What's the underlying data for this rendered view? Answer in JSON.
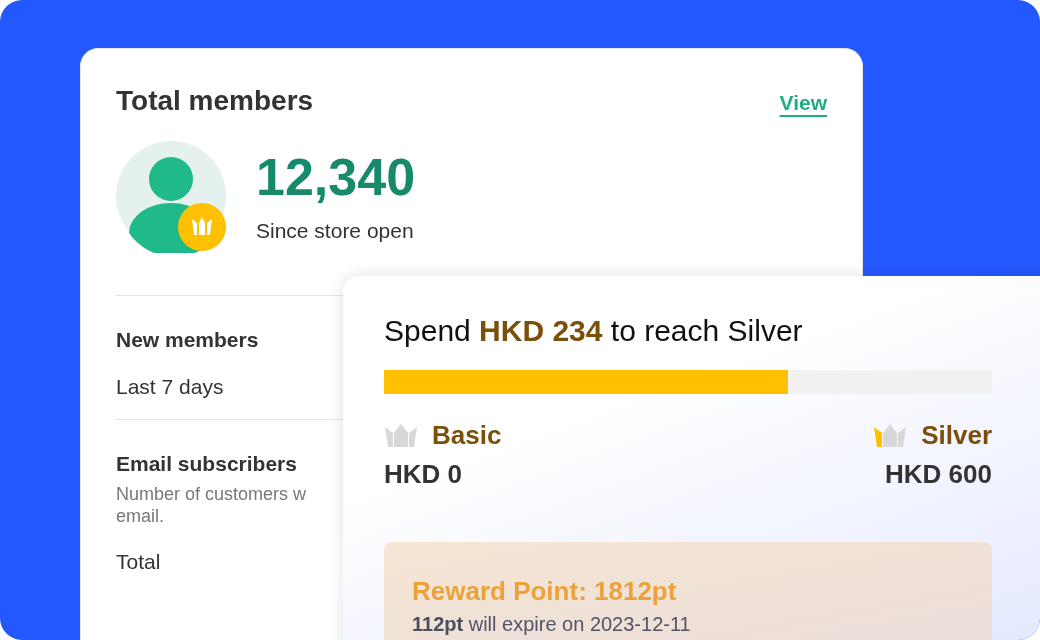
{
  "members_card": {
    "title": "Total members",
    "link": "View",
    "total": "12,340",
    "total_caption": "Since store open",
    "sections": [
      {
        "title": "New members",
        "lines": [
          "Last 7 days"
        ],
        "kind": "plain"
      },
      {
        "title": "Email subscribers",
        "lines": [
          "Number of customers w",
          "email."
        ],
        "value": "Total",
        "kind": "described"
      }
    ]
  },
  "tier_card": {
    "headline": "Spend **HKD 234** to reach Silver",
    "level": 0.665,
    "tiers": [
      {
        "name": "Basic",
        "amount": "HKD 0",
        "kind": "current"
      },
      {
        "name": "Silver",
        "amount": "HKD 600",
        "kind": "next"
      }
    ],
    "reward": {
      "title": "Reward Point: 1812pt",
      "note": "**112pt** will expire on 2023-12-11"
    }
  }
}
